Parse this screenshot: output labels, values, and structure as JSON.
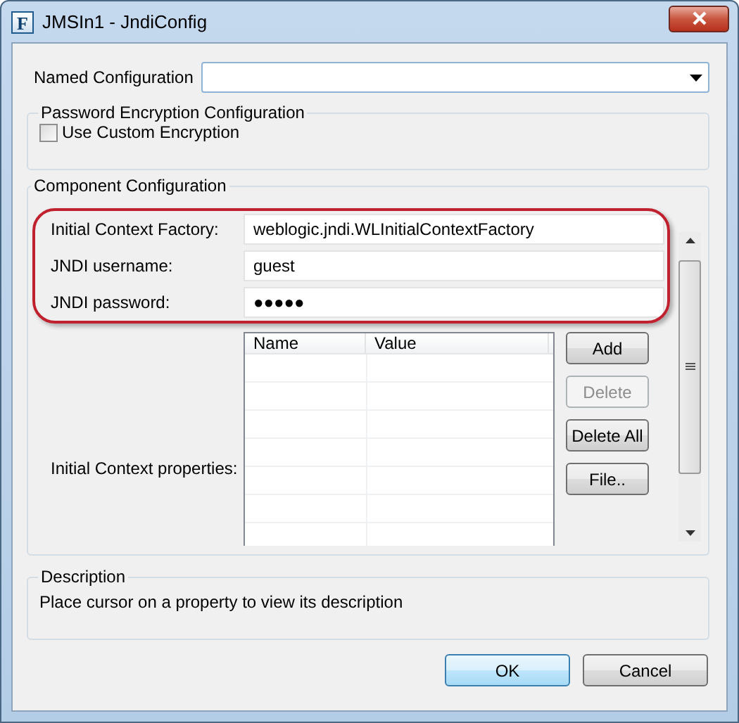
{
  "window": {
    "app_icon": "F",
    "title": "JMSIn1 - JndiConfig"
  },
  "named_configuration": {
    "label": "Named Configuration"
  },
  "password_encryption": {
    "legend": "Password Encryption Configuration",
    "use_custom": {
      "label": "Use Custom Encryption",
      "checked": false
    }
  },
  "component": {
    "legend": "Component Configuration",
    "fields": [
      {
        "label": "Initial Context Factory:",
        "value": "weblogic.jndi.WLInitialContextFactory"
      },
      {
        "label": "JNDI username:",
        "value": "guest"
      },
      {
        "label": "JNDI password:",
        "value": "●●●●●"
      }
    ],
    "properties": {
      "label": "Initial Context properties:",
      "columns": [
        "Name",
        "Value"
      ],
      "buttons": [
        {
          "label": "Add",
          "disabled": false
        },
        {
          "label": "Delete",
          "disabled": true
        },
        {
          "label": "Delete All",
          "disabled": false
        },
        {
          "label": "File..",
          "disabled": false
        }
      ]
    }
  },
  "description": {
    "legend": "Description",
    "text": "Place cursor on a property to view its description"
  },
  "buttons": [
    {
      "label": "OK",
      "default": true
    },
    {
      "label": "Cancel",
      "default": false
    }
  ]
}
